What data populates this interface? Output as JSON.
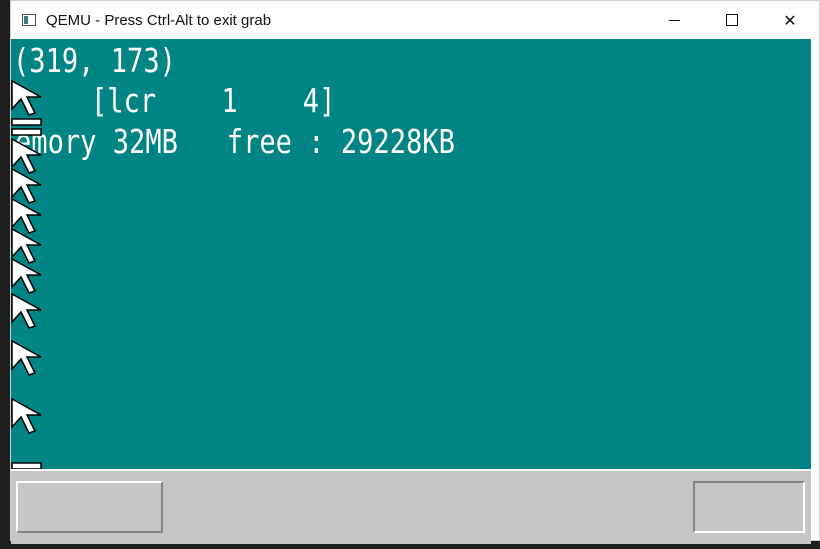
{
  "window": {
    "title": "QEMU - Press Ctrl-Alt to exit grab",
    "minimize_glyph": "–",
    "close_glyph": "✕"
  },
  "screen": {
    "background": "#008484",
    "text_color": "#ffffff",
    "mouse_coords": "(319, 173)",
    "keyboard_line": "[lcr    1    4]",
    "memory_line": "emory 32MB   free : 29228KB"
  },
  "taskbar": {
    "background": "#c6c6c6"
  }
}
